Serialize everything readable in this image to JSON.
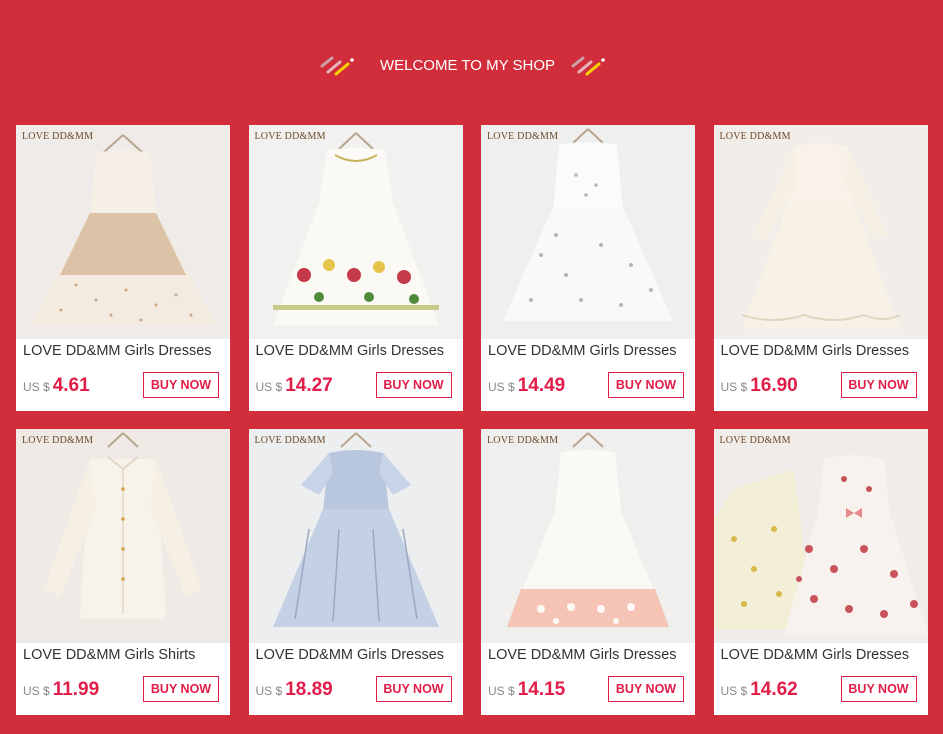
{
  "header": {
    "welcome_text": "WELCOME TO MY SHOP"
  },
  "colors": {
    "background": "#d22d3a",
    "accent": "#e11d48"
  },
  "products": [
    {
      "brand": "LOVE DD&MM",
      "title": "LOVE DD&MM Girls Dresses",
      "currency": "US $",
      "price": "4.61",
      "button": "BUY NOW"
    },
    {
      "brand": "LOVE DD&MM",
      "title": "LOVE DD&MM Girls Dresses",
      "currency": "US $",
      "price": "14.27",
      "button": "BUY NOW"
    },
    {
      "brand": "LOVE DD&MM",
      "title": "LOVE DD&MM Girls Dresses",
      "currency": "US $",
      "price": "14.49",
      "button": "BUY NOW"
    },
    {
      "brand": "LOVE DD&MM",
      "title": "LOVE DD&MM Girls Dresses",
      "currency": "US $",
      "price": "16.90",
      "button": "BUY NOW"
    },
    {
      "brand": "LOVE DD&MM",
      "title": "LOVE DD&MM Girls Shirts",
      "currency": "US $",
      "price": "11.99",
      "button": "BUY NOW"
    },
    {
      "brand": "LOVE DD&MM",
      "title": "LOVE DD&MM Girls Dresses",
      "currency": "US $",
      "price": "18.89",
      "button": "BUY NOW"
    },
    {
      "brand": "LOVE DD&MM",
      "title": "LOVE DD&MM Girls Dresses",
      "currency": "US $",
      "price": "14.15",
      "button": "BUY NOW"
    },
    {
      "brand": "LOVE DD&MM",
      "title": "LOVE DD&MM Girls Dresses",
      "currency": "US $",
      "price": "14.62",
      "button": "BUY NOW"
    }
  ]
}
